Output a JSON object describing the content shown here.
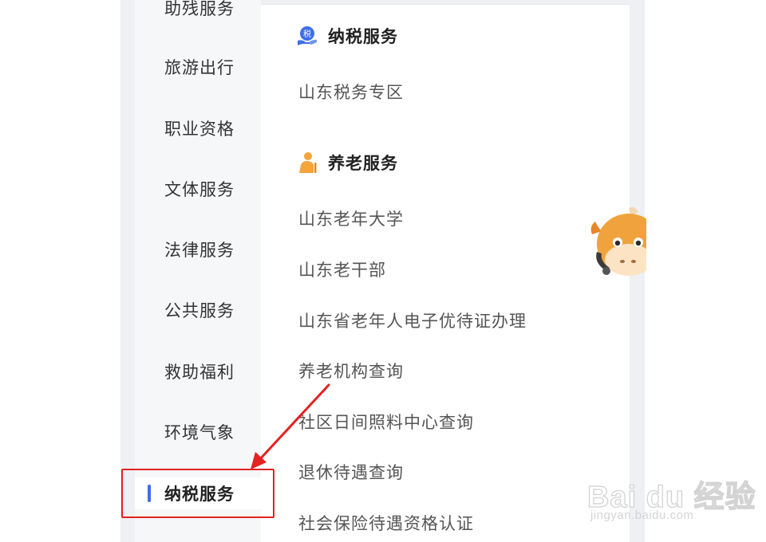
{
  "sidebar": {
    "items": [
      {
        "label": "助残服务"
      },
      {
        "label": "旅游出行"
      },
      {
        "label": "职业资格"
      },
      {
        "label": "文体服务"
      },
      {
        "label": "法律服务"
      },
      {
        "label": "公共服务"
      },
      {
        "label": "救助福利"
      },
      {
        "label": "环境气象"
      },
      {
        "label": "纳税服务"
      }
    ],
    "active_index": 8,
    "accent_color": "#3d6fe8"
  },
  "sections": [
    {
      "title": "纳税服务",
      "icon": "tax-hand-icon",
      "icon_text": "税",
      "icon_color": "#3d6fe8",
      "items": [
        "山东税务专区"
      ]
    },
    {
      "title": "养老服务",
      "icon": "elderly-person-icon",
      "icon_color": "#f4a43b",
      "items": [
        "山东老年大学",
        "山东老干部",
        "山东省老年人电子优待证办理",
        "养老机构查询",
        "社区日间照料中心查询",
        "退休待遇查询",
        "社会保险待遇资格认证"
      ]
    }
  ],
  "annotation": {
    "box_color": "#e32222",
    "arrow_color": "#e32222"
  },
  "watermark": {
    "brand": "Bai du 经验",
    "url": "jingyan.baidu.com"
  },
  "mascot": {
    "icon": "cow-mascot-icon"
  }
}
